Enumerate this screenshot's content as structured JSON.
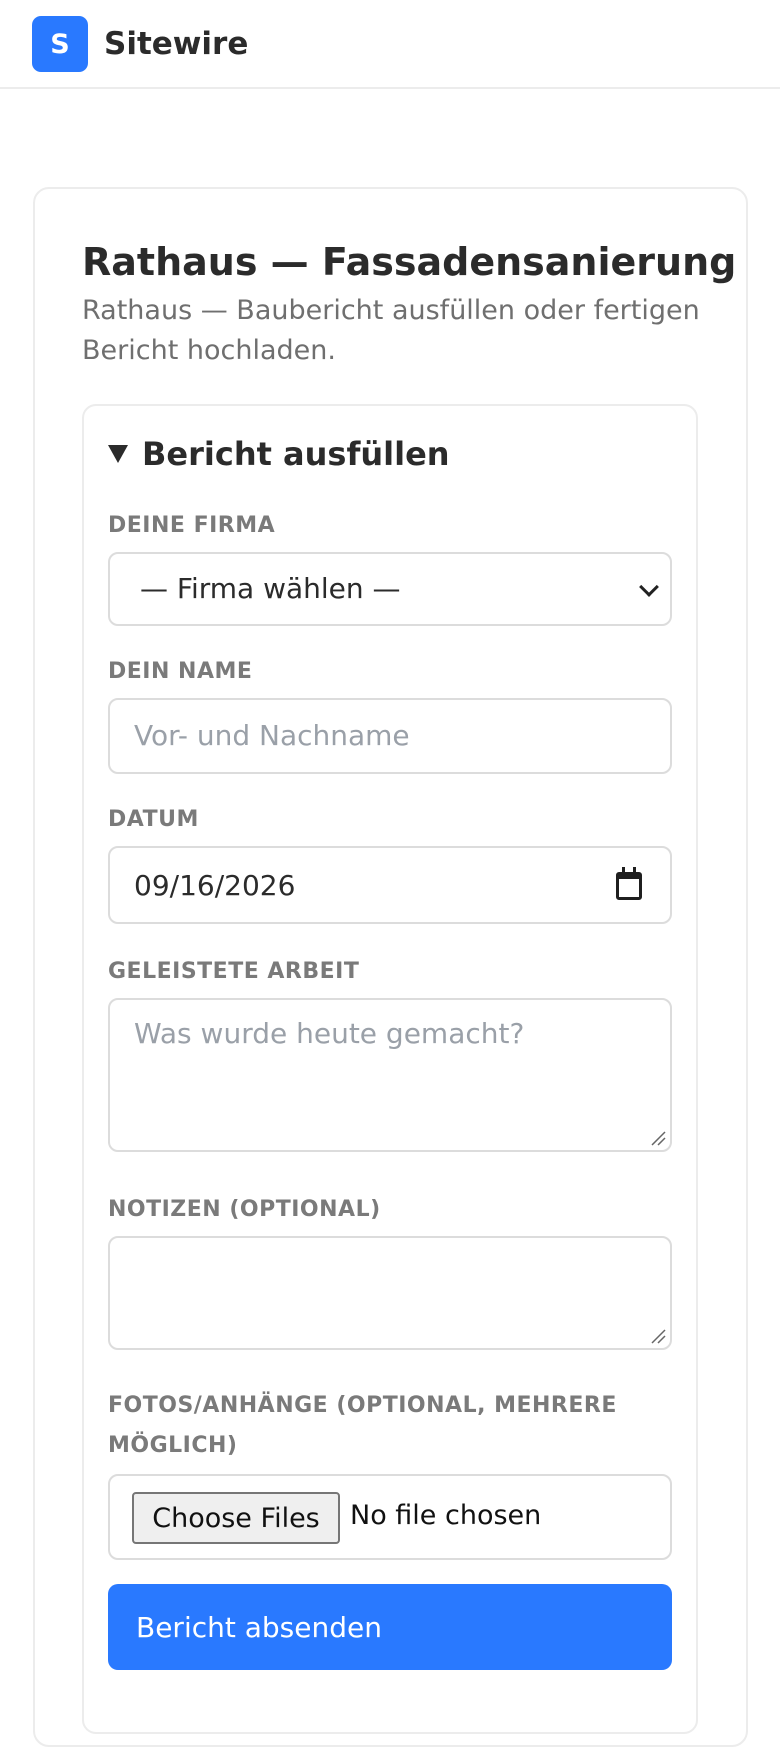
{
  "header": {
    "logo_letter": "S",
    "brand": "Sitewire",
    "brand_color": "#2979ff"
  },
  "page": {
    "title": "Rathaus — Fassadensanierung",
    "subtitle": "Rathaus — Baubericht ausfüllen oder fertigen Bericht hochladen."
  },
  "form": {
    "summary": "Bericht ausfüllen",
    "company_label": "DEINE FIRMA",
    "company_selected": "— Firma wählen —",
    "name_label": "DEIN NAME",
    "name_placeholder": "Vor- und Nachname",
    "date_label": "DATUM",
    "date_value": "09/16/2026",
    "work_label": "GELEISTETE ARBEIT",
    "work_placeholder": "Was wurde heute gemacht?",
    "notes_label": "NOTIZEN (OPTIONAL)",
    "files_label": "FOTOS/ANHÄNGE (OPTIONAL, MEHRERE MÖGLICH)",
    "choose_files": "Choose Files",
    "no_file": "No file chosen",
    "submit": "Bericht absenden"
  }
}
